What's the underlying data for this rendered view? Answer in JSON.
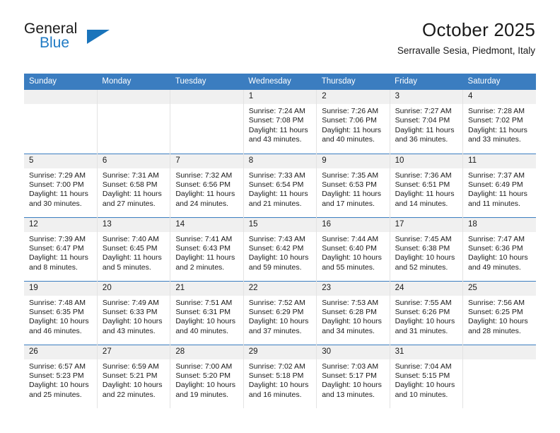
{
  "brand": {
    "name_top": "General",
    "name_bottom": "Blue",
    "triangle_color": "#1a74bb",
    "blue_color": "#1f7ac4"
  },
  "header": {
    "title": "October 2025",
    "subtitle": "Serravalle Sesia, Piedmont, Italy"
  },
  "theme": {
    "header_bg": "#3b7dc0",
    "daynum_bg": "#f0f0f0",
    "grid_line": "#e3e3e3",
    "week_line": "#3b7dc0"
  },
  "labels": {
    "sunrise_prefix": "Sunrise:",
    "sunset_prefix": "Sunset:",
    "daylight_prefix": "Daylight:"
  },
  "weekday_headers": [
    "Sunday",
    "Monday",
    "Tuesday",
    "Wednesday",
    "Thursday",
    "Friday",
    "Saturday"
  ],
  "weeks": [
    [
      {
        "day": "",
        "sunrise": "",
        "sunset": "",
        "daylight_line1": "",
        "daylight_line2": "",
        "empty": true
      },
      {
        "day": "",
        "sunrise": "",
        "sunset": "",
        "daylight_line1": "",
        "daylight_line2": "",
        "empty": true
      },
      {
        "day": "",
        "sunrise": "",
        "sunset": "",
        "daylight_line1": "",
        "daylight_line2": "",
        "empty": true
      },
      {
        "day": "1",
        "sunrise": "Sunrise: 7:24 AM",
        "sunset": "Sunset: 7:08 PM",
        "daylight_line1": "Daylight: 11 hours",
        "daylight_line2": "and 43 minutes.",
        "empty": false
      },
      {
        "day": "2",
        "sunrise": "Sunrise: 7:26 AM",
        "sunset": "Sunset: 7:06 PM",
        "daylight_line1": "Daylight: 11 hours",
        "daylight_line2": "and 40 minutes.",
        "empty": false
      },
      {
        "day": "3",
        "sunrise": "Sunrise: 7:27 AM",
        "sunset": "Sunset: 7:04 PM",
        "daylight_line1": "Daylight: 11 hours",
        "daylight_line2": "and 36 minutes.",
        "empty": false
      },
      {
        "day": "4",
        "sunrise": "Sunrise: 7:28 AM",
        "sunset": "Sunset: 7:02 PM",
        "daylight_line1": "Daylight: 11 hours",
        "daylight_line2": "and 33 minutes.",
        "empty": false
      }
    ],
    [
      {
        "day": "5",
        "sunrise": "Sunrise: 7:29 AM",
        "sunset": "Sunset: 7:00 PM",
        "daylight_line1": "Daylight: 11 hours",
        "daylight_line2": "and 30 minutes.",
        "empty": false
      },
      {
        "day": "6",
        "sunrise": "Sunrise: 7:31 AM",
        "sunset": "Sunset: 6:58 PM",
        "daylight_line1": "Daylight: 11 hours",
        "daylight_line2": "and 27 minutes.",
        "empty": false
      },
      {
        "day": "7",
        "sunrise": "Sunrise: 7:32 AM",
        "sunset": "Sunset: 6:56 PM",
        "daylight_line1": "Daylight: 11 hours",
        "daylight_line2": "and 24 minutes.",
        "empty": false
      },
      {
        "day": "8",
        "sunrise": "Sunrise: 7:33 AM",
        "sunset": "Sunset: 6:54 PM",
        "daylight_line1": "Daylight: 11 hours",
        "daylight_line2": "and 21 minutes.",
        "empty": false
      },
      {
        "day": "9",
        "sunrise": "Sunrise: 7:35 AM",
        "sunset": "Sunset: 6:53 PM",
        "daylight_line1": "Daylight: 11 hours",
        "daylight_line2": "and 17 minutes.",
        "empty": false
      },
      {
        "day": "10",
        "sunrise": "Sunrise: 7:36 AM",
        "sunset": "Sunset: 6:51 PM",
        "daylight_line1": "Daylight: 11 hours",
        "daylight_line2": "and 14 minutes.",
        "empty": false
      },
      {
        "day": "11",
        "sunrise": "Sunrise: 7:37 AM",
        "sunset": "Sunset: 6:49 PM",
        "daylight_line1": "Daylight: 11 hours",
        "daylight_line2": "and 11 minutes.",
        "empty": false
      }
    ],
    [
      {
        "day": "12",
        "sunrise": "Sunrise: 7:39 AM",
        "sunset": "Sunset: 6:47 PM",
        "daylight_line1": "Daylight: 11 hours",
        "daylight_line2": "and 8 minutes.",
        "empty": false
      },
      {
        "day": "13",
        "sunrise": "Sunrise: 7:40 AM",
        "sunset": "Sunset: 6:45 PM",
        "daylight_line1": "Daylight: 11 hours",
        "daylight_line2": "and 5 minutes.",
        "empty": false
      },
      {
        "day": "14",
        "sunrise": "Sunrise: 7:41 AM",
        "sunset": "Sunset: 6:43 PM",
        "daylight_line1": "Daylight: 11 hours",
        "daylight_line2": "and 2 minutes.",
        "empty": false
      },
      {
        "day": "15",
        "sunrise": "Sunrise: 7:43 AM",
        "sunset": "Sunset: 6:42 PM",
        "daylight_line1": "Daylight: 10 hours",
        "daylight_line2": "and 59 minutes.",
        "empty": false
      },
      {
        "day": "16",
        "sunrise": "Sunrise: 7:44 AM",
        "sunset": "Sunset: 6:40 PM",
        "daylight_line1": "Daylight: 10 hours",
        "daylight_line2": "and 55 minutes.",
        "empty": false
      },
      {
        "day": "17",
        "sunrise": "Sunrise: 7:45 AM",
        "sunset": "Sunset: 6:38 PM",
        "daylight_line1": "Daylight: 10 hours",
        "daylight_line2": "and 52 minutes.",
        "empty": false
      },
      {
        "day": "18",
        "sunrise": "Sunrise: 7:47 AM",
        "sunset": "Sunset: 6:36 PM",
        "daylight_line1": "Daylight: 10 hours",
        "daylight_line2": "and 49 minutes.",
        "empty": false
      }
    ],
    [
      {
        "day": "19",
        "sunrise": "Sunrise: 7:48 AM",
        "sunset": "Sunset: 6:35 PM",
        "daylight_line1": "Daylight: 10 hours",
        "daylight_line2": "and 46 minutes.",
        "empty": false
      },
      {
        "day": "20",
        "sunrise": "Sunrise: 7:49 AM",
        "sunset": "Sunset: 6:33 PM",
        "daylight_line1": "Daylight: 10 hours",
        "daylight_line2": "and 43 minutes.",
        "empty": false
      },
      {
        "day": "21",
        "sunrise": "Sunrise: 7:51 AM",
        "sunset": "Sunset: 6:31 PM",
        "daylight_line1": "Daylight: 10 hours",
        "daylight_line2": "and 40 minutes.",
        "empty": false
      },
      {
        "day": "22",
        "sunrise": "Sunrise: 7:52 AM",
        "sunset": "Sunset: 6:29 PM",
        "daylight_line1": "Daylight: 10 hours",
        "daylight_line2": "and 37 minutes.",
        "empty": false
      },
      {
        "day": "23",
        "sunrise": "Sunrise: 7:53 AM",
        "sunset": "Sunset: 6:28 PM",
        "daylight_line1": "Daylight: 10 hours",
        "daylight_line2": "and 34 minutes.",
        "empty": false
      },
      {
        "day": "24",
        "sunrise": "Sunrise: 7:55 AM",
        "sunset": "Sunset: 6:26 PM",
        "daylight_line1": "Daylight: 10 hours",
        "daylight_line2": "and 31 minutes.",
        "empty": false
      },
      {
        "day": "25",
        "sunrise": "Sunrise: 7:56 AM",
        "sunset": "Sunset: 6:25 PM",
        "daylight_line1": "Daylight: 10 hours",
        "daylight_line2": "and 28 minutes.",
        "empty": false
      }
    ],
    [
      {
        "day": "26",
        "sunrise": "Sunrise: 6:57 AM",
        "sunset": "Sunset: 5:23 PM",
        "daylight_line1": "Daylight: 10 hours",
        "daylight_line2": "and 25 minutes.",
        "empty": false
      },
      {
        "day": "27",
        "sunrise": "Sunrise: 6:59 AM",
        "sunset": "Sunset: 5:21 PM",
        "daylight_line1": "Daylight: 10 hours",
        "daylight_line2": "and 22 minutes.",
        "empty": false
      },
      {
        "day": "28",
        "sunrise": "Sunrise: 7:00 AM",
        "sunset": "Sunset: 5:20 PM",
        "daylight_line1": "Daylight: 10 hours",
        "daylight_line2": "and 19 minutes.",
        "empty": false
      },
      {
        "day": "29",
        "sunrise": "Sunrise: 7:02 AM",
        "sunset": "Sunset: 5:18 PM",
        "daylight_line1": "Daylight: 10 hours",
        "daylight_line2": "and 16 minutes.",
        "empty": false
      },
      {
        "day": "30",
        "sunrise": "Sunrise: 7:03 AM",
        "sunset": "Sunset: 5:17 PM",
        "daylight_line1": "Daylight: 10 hours",
        "daylight_line2": "and 13 minutes.",
        "empty": false
      },
      {
        "day": "31",
        "sunrise": "Sunrise: 7:04 AM",
        "sunset": "Sunset: 5:15 PM",
        "daylight_line1": "Daylight: 10 hours",
        "daylight_line2": "and 10 minutes.",
        "empty": false
      },
      {
        "day": "",
        "sunrise": "",
        "sunset": "",
        "daylight_line1": "",
        "daylight_line2": "",
        "empty": true
      }
    ]
  ]
}
